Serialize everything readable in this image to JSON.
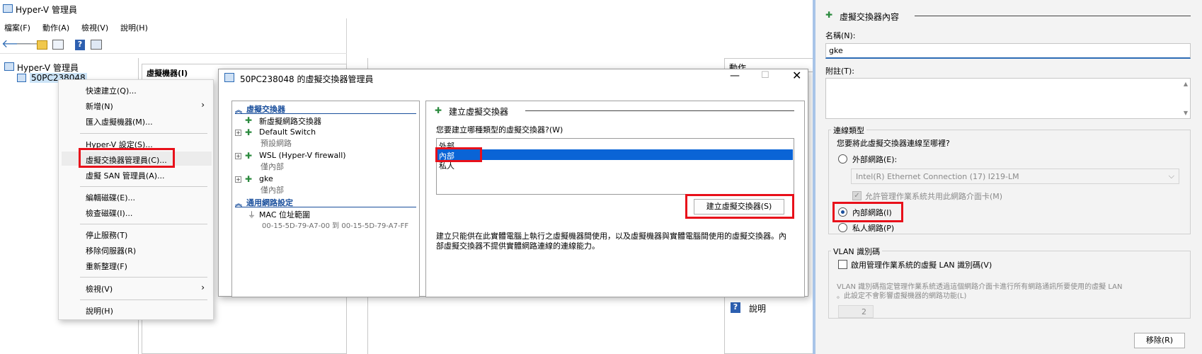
{
  "hv": {
    "title": "Hyper-V 管理員",
    "menu": [
      "檔案(F)",
      "動作(A)",
      "檢視(V)",
      "說明(H)"
    ],
    "tree_root": "Hyper-V 管理員",
    "tree_server": "50PC238048",
    "vm_header": "虛擬機器(I)",
    "actions_header": "動作",
    "actions_help": "說明"
  },
  "context_menu": {
    "items": [
      "快速建立(Q)...",
      "新增(N)",
      "匯入虛擬機器(M)...",
      "Hyper-V 設定(S)...",
      "虛擬交換器管理員(C)...",
      "虛擬 SAN 管理員(A)...",
      "編輯磁碟(E)...",
      "檢查磁碟(I)...",
      "停止服務(T)",
      "移除伺服器(R)",
      "重新整理(F)",
      "檢視(V)",
      "說明(H)"
    ]
  },
  "vsm": {
    "title": "50PC238048 的虛擬交換器管理員",
    "section_switches": "虛擬交換器",
    "new_switch": "新虛擬網路交換器",
    "switches": [
      {
        "name": "Default Switch",
        "type": "預設網路"
      },
      {
        "name": "WSL (Hyper-V firewall)",
        "type": "僅內部"
      },
      {
        "name": "gke",
        "type": "僅內部"
      }
    ],
    "section_global": "通用網路設定",
    "mac_label": "MAC 位址範圍",
    "mac_range": "00-15-5D-79-A7-00 到 00-15-5D-79-A7-FF",
    "panel_title": "建立虛擬交換器",
    "question": "您要建立哪種類型的虛擬交換器?(W)",
    "types": [
      "外部",
      "內部",
      "私人"
    ],
    "selected_type": "內部",
    "create_button": "建立虛擬交換器(S)",
    "description": "建立只能供在此實體電腦上執行之虛擬機器間使用，以及虛擬機器與實體電腦間使用的虛擬交換器。內部虛擬交換器不提供實體網路連線的連線能力。"
  },
  "props": {
    "title": "虛擬交換器內容",
    "name_label": "名稱(N):",
    "name_value": "gke",
    "notes_label": "附註(T):",
    "conn_type": "連線類型",
    "conn_question": "您要將此虛擬交換器連線至哪裡?",
    "external": "外部網路(E):",
    "adapter": "Intel(R) Ethernet Connection (17) I219-LM",
    "allow_mgmt": "允許管理作業系統共用此網路介面卡(M)",
    "internal": "內部網路(I)",
    "private": "私人網路(P)",
    "vlan_group": "VLAN 識別碼",
    "vlan_enable": "啟用管理作業系統的虛擬 LAN 識別碼(V)",
    "vlan_desc_1": "VLAN 識別碼指定管理作業系統透過這個網路介面卡進行所有網路通訊所要使用的虛擬 LAN",
    "vlan_desc_2": "。此設定不會影響虛擬機器的網路功能(L)",
    "vlan_value": "2",
    "remove_button": "移除(R)"
  },
  "colors": {
    "accent": "#1a4f9c",
    "selection": "#0a64d6",
    "highlight_box": "#e8101a"
  }
}
